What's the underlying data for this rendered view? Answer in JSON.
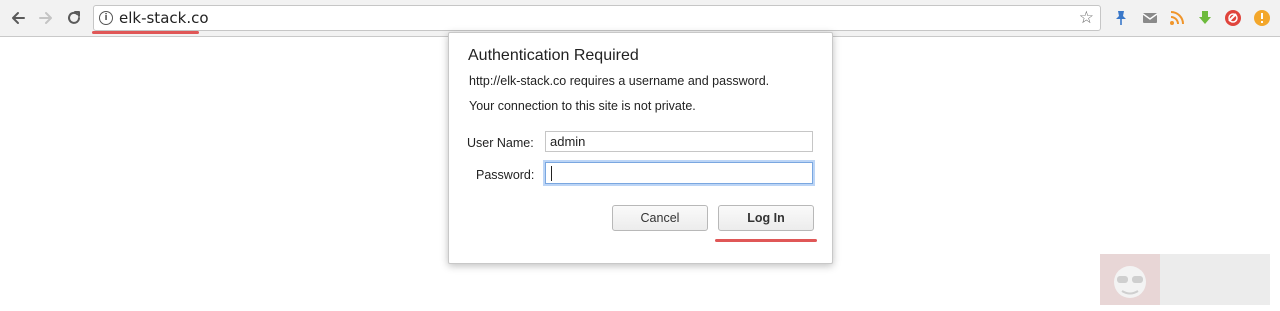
{
  "browser": {
    "url": "elk-stack.co",
    "nav_icons": [
      "back-arrow-icon",
      "forward-arrow-icon",
      "reload-icon"
    ],
    "omnibox_icons": [
      "info-icon",
      "star-icon"
    ],
    "extensions": [
      "pushpin-icon",
      "mail-icon",
      "rss-icon",
      "download-icon",
      "block-icon",
      "alert-icon"
    ],
    "highlight_color": "#e05757"
  },
  "dialog": {
    "title": "Authentication Required",
    "message_line1": "http://elk-stack.co requires a username and password.",
    "message_line2": "Your connection to this site is not private.",
    "username_label": "User Name:",
    "username_value": "admin",
    "password_label": "Password:",
    "password_value": "",
    "cancel_label": "Cancel",
    "login_label": "Log In"
  },
  "watermark": {
    "icon": "mascot-logo-icon"
  }
}
